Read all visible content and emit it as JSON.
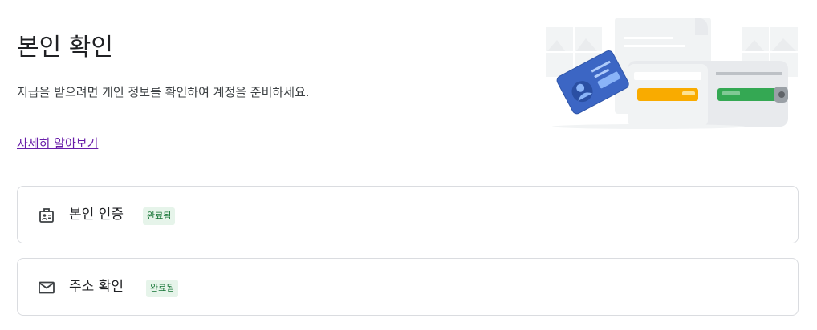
{
  "header": {
    "title": "본인 확인",
    "description": "지급을 받으려면 개인 정보를 확인하여 계정을 준비하세요.",
    "learn_more_label": "자세히 알아보기"
  },
  "illustration": {
    "name": "wallet-id-card-illustration"
  },
  "verification_items": [
    {
      "label": "본인 인증",
      "status": "완료됨",
      "icon": "id-badge-icon"
    },
    {
      "label": "주소 확인",
      "status": "완료됨",
      "icon": "mail-icon"
    }
  ],
  "colors": {
    "title_text": "#202124",
    "link": "#681da8",
    "badge_text": "#137333",
    "badge_background": "#e6f4ea",
    "card_border": "#dadce0",
    "id_card_blue": "#3c66c4",
    "card_yellow": "#f9ab00",
    "card_green": "#34a853"
  }
}
